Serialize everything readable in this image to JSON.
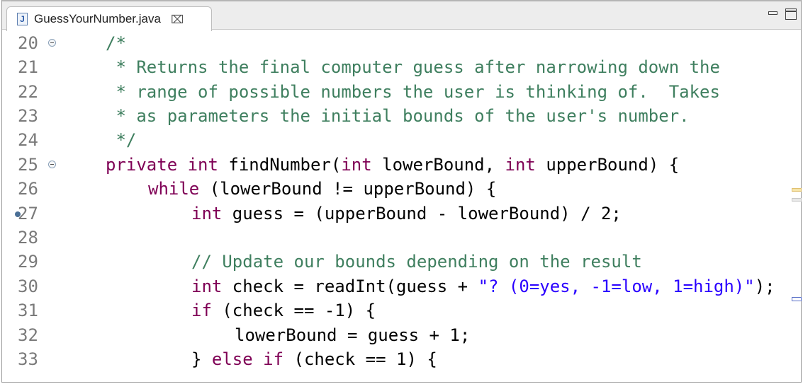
{
  "tab": {
    "icon": "java-file-icon",
    "icon_letter": "J",
    "title": "GuessYourNumber.java",
    "close": "⌧"
  },
  "window_controls": {
    "minimize": "minimize-icon",
    "maximize": "maximize-icon"
  },
  "lines": [
    {
      "num": "20",
      "text": "/*"
    },
    {
      "num": "21",
      "text": " * Returns the final computer guess after narrowing down the"
    },
    {
      "num": "22",
      "text": " * range of possible numbers the user is thinking of.  Takes"
    },
    {
      "num": "23",
      "text": " * as parameters the initial bounds of the user's number."
    },
    {
      "num": "24",
      "text": " */"
    },
    {
      "num": "25",
      "kw1": "private int ",
      "rest1": "findNumber(",
      "kw2": "int ",
      "rest2": "lowerBound, ",
      "kw3": "int ",
      "rest3": "upperBound) {"
    },
    {
      "num": "26",
      "kw1": "while ",
      "rest1": "(lowerBound != upperBound) {"
    },
    {
      "num": "27",
      "kw1": "int ",
      "rest1": "guess = (upperBound - lowerBound) / 2;"
    },
    {
      "num": "28"
    },
    {
      "num": "29",
      "text": "// Update our bounds depending on the result"
    },
    {
      "num": "30",
      "kw1": "int ",
      "rest1": "check = readInt(guess + ",
      "str": "\"? (0=yes, -1=low, 1=high)\"",
      "rest2": ");"
    },
    {
      "num": "31",
      "kw1": "if ",
      "rest1": "(check == -1) {"
    },
    {
      "num": "32",
      "rest1": "lowerBound = guess + 1;"
    },
    {
      "num": "33",
      "rest0": "} ",
      "kw1": "else if ",
      "rest1": "(check == 1) {"
    }
  ],
  "colors": {
    "comment": "#3f7f5f",
    "keyword": "#7f0055",
    "string": "#2a00ff"
  }
}
